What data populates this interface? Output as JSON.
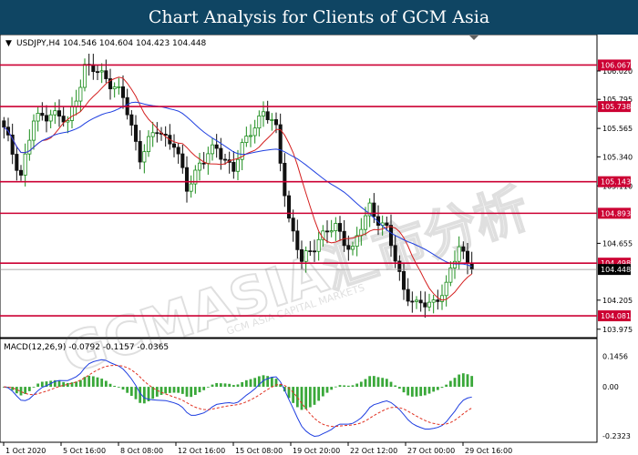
{
  "banner": {
    "title": "Chart Analysis for Clients of GCM Asia"
  },
  "watermark": {
    "text": "GCMASIA汇市分析",
    "subtext": "GCM ASIA CAPITAL MARKETS"
  },
  "colors": {
    "bull": "#1a8c1a",
    "bear": "#111111",
    "ma_fast": "#d42020",
    "ma_slow": "#2040e0",
    "level": "#cc0033",
    "level_label_bg": "#cc0033",
    "price_label_bg": "#000000",
    "macd_hist": "#3aa83a",
    "macd_signal": "#e03020",
    "macd_line": "#1e3ee0"
  },
  "chart_data": [
    {
      "type": "candlestick",
      "title": "",
      "header": "USDJPY,H4  104.546 104.604 104.423 104.448",
      "ylim": [
        103.93,
        106.2
      ],
      "y_ticks": [
        106.02,
        105.795,
        105.565,
        105.34,
        105.11,
        104.655,
        104.205,
        103.975
      ],
      "x_ticks": [
        "1 Oct 2020",
        "5 Oct 16:00",
        "8 Oct 08:00",
        "12 Oct 16:00",
        "15 Oct 08:00",
        "19 Oct 20:00",
        "22 Oct 12:00",
        "27 Oct 00:00",
        "29 Oct 16:00"
      ],
      "levels": [
        106.067,
        105.738,
        105.143,
        104.893,
        104.498,
        104.081
      ],
      "current_price": 104.448,
      "current_price_label": "104.448",
      "key_points": [
        {
          "bar": 0,
          "price": 105.55
        },
        {
          "bar": 4,
          "price": 105.2
        },
        {
          "bar": 7,
          "price": 105.62
        },
        {
          "bar": 11,
          "price": 105.7
        },
        {
          "bar": 15,
          "price": 105.6
        },
        {
          "bar": 19,
          "price": 106.05
        },
        {
          "bar": 24,
          "price": 105.98
        },
        {
          "bar": 28,
          "price": 105.8
        },
        {
          "bar": 32,
          "price": 105.35
        },
        {
          "bar": 36,
          "price": 105.55
        },
        {
          "bar": 40,
          "price": 105.45
        },
        {
          "bar": 43,
          "price": 105.08
        },
        {
          "bar": 46,
          "price": 105.3
        },
        {
          "bar": 50,
          "price": 105.4
        },
        {
          "bar": 54,
          "price": 105.25
        },
        {
          "bar": 58,
          "price": 105.55
        },
        {
          "bar": 61,
          "price": 105.7
        },
        {
          "bar": 64,
          "price": 105.55
        },
        {
          "bar": 67,
          "price": 104.85
        },
        {
          "bar": 70,
          "price": 104.5
        },
        {
          "bar": 74,
          "price": 104.7
        },
        {
          "bar": 78,
          "price": 104.78
        },
        {
          "bar": 82,
          "price": 104.6
        },
        {
          "bar": 86,
          "price": 104.95
        },
        {
          "bar": 90,
          "price": 104.75
        },
        {
          "bar": 94,
          "price": 104.3
        },
        {
          "bar": 97,
          "price": 104.15
        },
        {
          "bar": 101,
          "price": 104.2
        },
        {
          "bar": 104,
          "price": 104.3
        },
        {
          "bar": 107,
          "price": 104.65
        },
        {
          "bar": 110,
          "price": 104.448
        }
      ]
    },
    {
      "type": "macd",
      "header": "MACD(12,26,9) -0.0792 -0.1157 -0.0365",
      "ylim": [
        -0.25,
        0.16
      ],
      "y_ticks": [
        0.1456,
        0.0,
        -0.2323
      ],
      "y_tick_labels": [
        "0.1456",
        "0.00",
        "-0.2323"
      ]
    }
  ]
}
